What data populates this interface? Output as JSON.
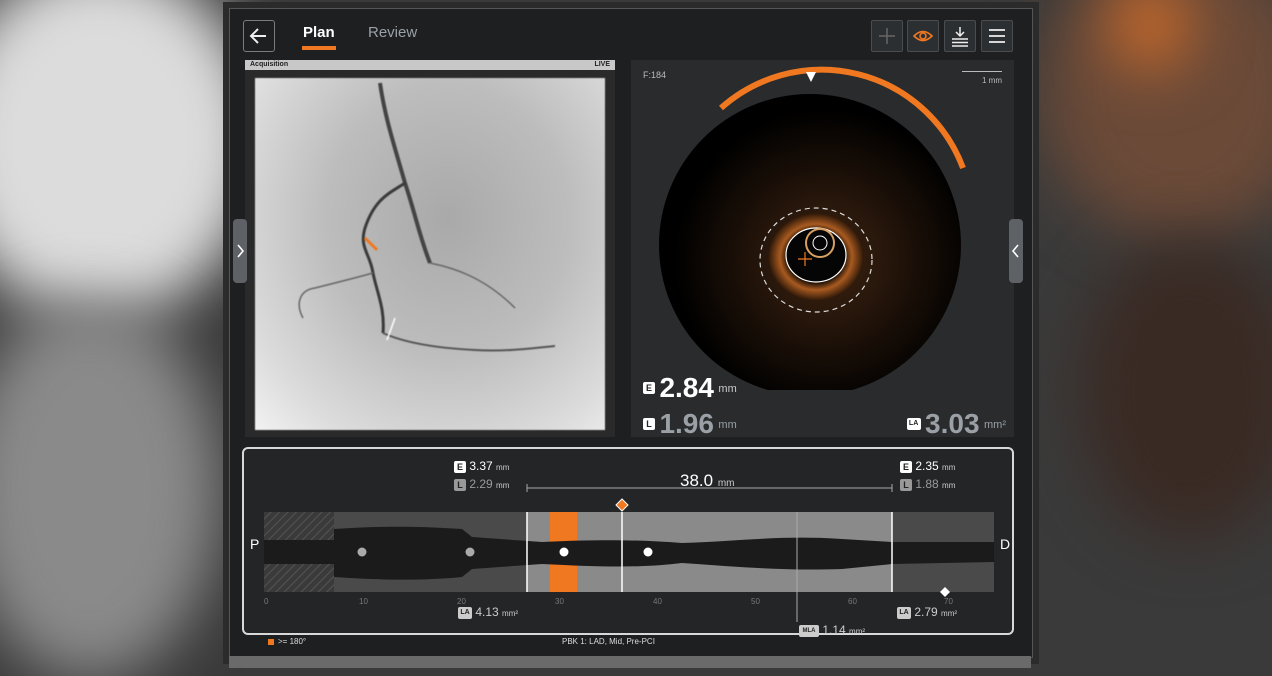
{
  "nav": {
    "tabs": [
      {
        "label": "Plan",
        "active": true
      },
      {
        "label": "Review",
        "active": false
      }
    ]
  },
  "toolbar": {
    "icons": [
      "plus-icon",
      "eye-icon",
      "download-icon",
      "menu-icon"
    ],
    "accent_color": "#f07820"
  },
  "angio": {
    "header_left": "Acquisition",
    "header_right": "LIVE"
  },
  "oct": {
    "frame": "F:184",
    "scale": "1 mm",
    "eem": {
      "badge": "E",
      "value": "2.84",
      "unit": "mm"
    },
    "lumen": {
      "badge": "L",
      "value": "1.96",
      "unit": "mm"
    },
    "lumen_area": {
      "badge": "LA",
      "value": "3.03",
      "unit": "mm²"
    }
  },
  "longitudinal": {
    "proximal_label": "P",
    "distal_label": "D",
    "proximal_ref": {
      "eem": "3.37",
      "lumen": "2.29",
      "unit": "mm"
    },
    "distal_ref": {
      "eem": "2.35",
      "lumen": "1.88",
      "unit": "mm"
    },
    "length": {
      "value": "38.0",
      "unit": "mm"
    },
    "prox_la": {
      "value": "4.13",
      "unit": "mm²"
    },
    "dist_la": {
      "value": "2.79",
      "unit": "mm²"
    },
    "mla": {
      "label": "MLA",
      "value": "1.14",
      "unit": "mm²"
    },
    "axis_ticks": [
      "0",
      "10",
      "20",
      "30",
      "40",
      "50",
      "60",
      "70"
    ]
  },
  "footer": {
    "legend": ">= 180°",
    "study": "PBK 1:  LAD,  Mid,  Pre-PCI"
  }
}
